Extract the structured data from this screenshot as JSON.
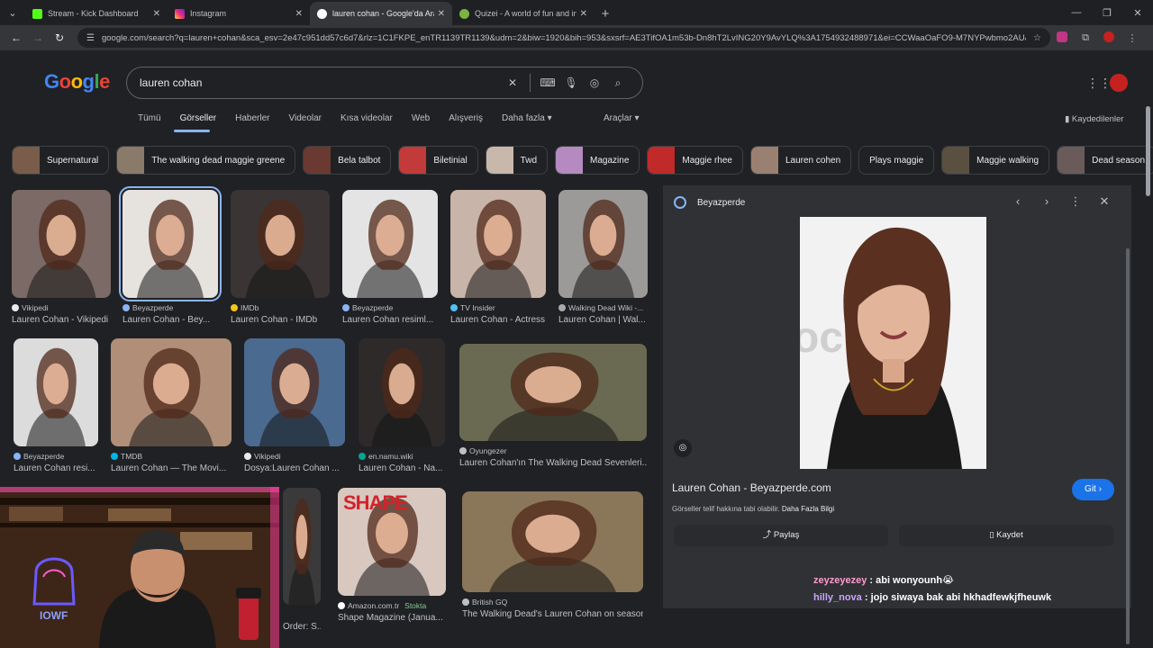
{
  "browser": {
    "tabs": [
      {
        "title": "Stream - Kick Dashboard",
        "favicon_color": "#53fc18",
        "active": false
      },
      {
        "title": "Instagram",
        "favicon_color": "#e1306c",
        "active": false
      },
      {
        "title": "lauren cohan - Google'da Ara",
        "favicon_color": "#ffffff",
        "active": true
      },
      {
        "title": "Quizei - A world of fun and inte",
        "favicon_color": "#7cb342",
        "active": false
      }
    ],
    "url": "google.com/search?q=lauren+cohan&sca_esv=2e47c951dd57c6d7&rlz=1C1FKPE_enTR1139TR1139&udm=2&biw=1920&bih=953&sxsrf=AE3TifOA1m53b-Dn8hT2LvING20Y9AvYLQ%3A1754932488971&ei=CCWaaOaFO9-M7NYPwbmo2AU&oq=la..."
  },
  "google": {
    "logo": [
      "G",
      "o",
      "o",
      "g",
      "l",
      "e"
    ],
    "query": "lauren cohan",
    "nav_tabs": [
      "Tümü",
      "Görseller",
      "Haberler",
      "Videolar",
      "Kısa videolar",
      "Web",
      "Alışveriş",
      "Daha fazla ▾"
    ],
    "tools": "Araçlar ▾",
    "saved": "Kaydedilenler",
    "chips": [
      {
        "label": "Supernatural",
        "color": "#7a5c4a"
      },
      {
        "label": "The walking dead maggie greene",
        "color": "#8a7a6a"
      },
      {
        "label": "Bela talbot",
        "color": "#6a3a32"
      },
      {
        "label": "Biletinial",
        "color": "#c23a3a"
      },
      {
        "label": "Twd",
        "color": "#c8b8ac"
      },
      {
        "label": "Magazine",
        "color": "#b48ac0"
      },
      {
        "label": "Maggie rhee",
        "color": "#c02a2a"
      },
      {
        "label": "Lauren cohen",
        "color": "#9a8070"
      },
      {
        "label": "Plays maggie",
        "color": ""
      },
      {
        "label": "Maggie walking",
        "color": "#5a5040"
      },
      {
        "label": "Dead season",
        "color": "#6a5a5a"
      }
    ],
    "results": [
      {
        "source": "Vikipedi",
        "caption": "Lauren Cohan - Vikipedi",
        "bg": "#7b6a65",
        "dot": "#e8eaed"
      },
      {
        "source": "Beyazperde",
        "caption": "Lauren Cohan - Bey...",
        "bg": "#e6e2de",
        "dot": "#8ab4f8"
      },
      {
        "source": "IMDb",
        "caption": "Lauren Cohan - IMDb",
        "bg": "#3a3434",
        "dot": "#f5c518"
      },
      {
        "source": "Beyazperde",
        "caption": "Lauren Cohan resiml...",
        "bg": "#e4e4e4",
        "dot": "#8ab4f8"
      },
      {
        "source": "TV Insider",
        "caption": "Lauren Cohan - Actress",
        "bg": "#c8b4a8",
        "dot": "#4fc3f7"
      },
      {
        "source": "Walking Dead Wiki -...",
        "caption": "Lauren Cohan | Wal...",
        "bg": "#9c9a98",
        "dot": "#aaaaaa"
      },
      {
        "source": "Beyazperde",
        "caption": "Lauren Cohan resi...",
        "bg": "#dcdcdc",
        "dot": "#8ab4f8"
      },
      {
        "source": "TMDB",
        "caption": "Lauren Cohan — The Movi...",
        "bg": "#b08e78",
        "dot": "#01b4e4"
      },
      {
        "source": "Vikipedi",
        "caption": "Dosya:Lauren Cohan ...",
        "bg": "#4a6a90",
        "dot": "#e8eaed"
      },
      {
        "source": "en.namu.wiki",
        "caption": "Lauren Cohan - Na...",
        "bg": "#2e2a2a",
        "dot": "#00a495"
      },
      {
        "source": "Oyungezer",
        "caption": "Lauren Cohan'ın The Walking Dead Sevenleri...",
        "bg": "#6a6a52",
        "dot": "#bdc1c6"
      },
      {
        "source": "",
        "caption": "Order: S...",
        "bg": "#3a3a3a",
        "dot": ""
      },
      {
        "source": "Amazon.com.tr",
        "caption": "Shape Magazine (Janua...",
        "bg": "#d8c8c0",
        "dot": "#ffffff",
        "extra": "Stokta"
      },
      {
        "source": "British GQ",
        "caption": "The Walking Dead's Lauren Cohan on season...",
        "bg": "#8a7658",
        "dot": "#bdc1c6"
      }
    ],
    "shape_cover": "SHAPE",
    "panel": {
      "source": "Beyazperde",
      "title": "Lauren Cohan - Beyazperde.com",
      "go_label": "Git ›",
      "note": "Görseller telif hakkına tabi olabilir.",
      "note_link": "Daha Fazla Bilgi",
      "share": "Paylaş",
      "save": "Kaydet"
    }
  },
  "chat": [
    {
      "user": "zeyzeyezey",
      "message": ": abi wonyounh😭"
    },
    {
      "user": "hilly_nova",
      "message": ": jojo siwaya bak abi hkhadfewkjfheuwk"
    }
  ],
  "webcam": {
    "logo_text": "IOWF"
  }
}
